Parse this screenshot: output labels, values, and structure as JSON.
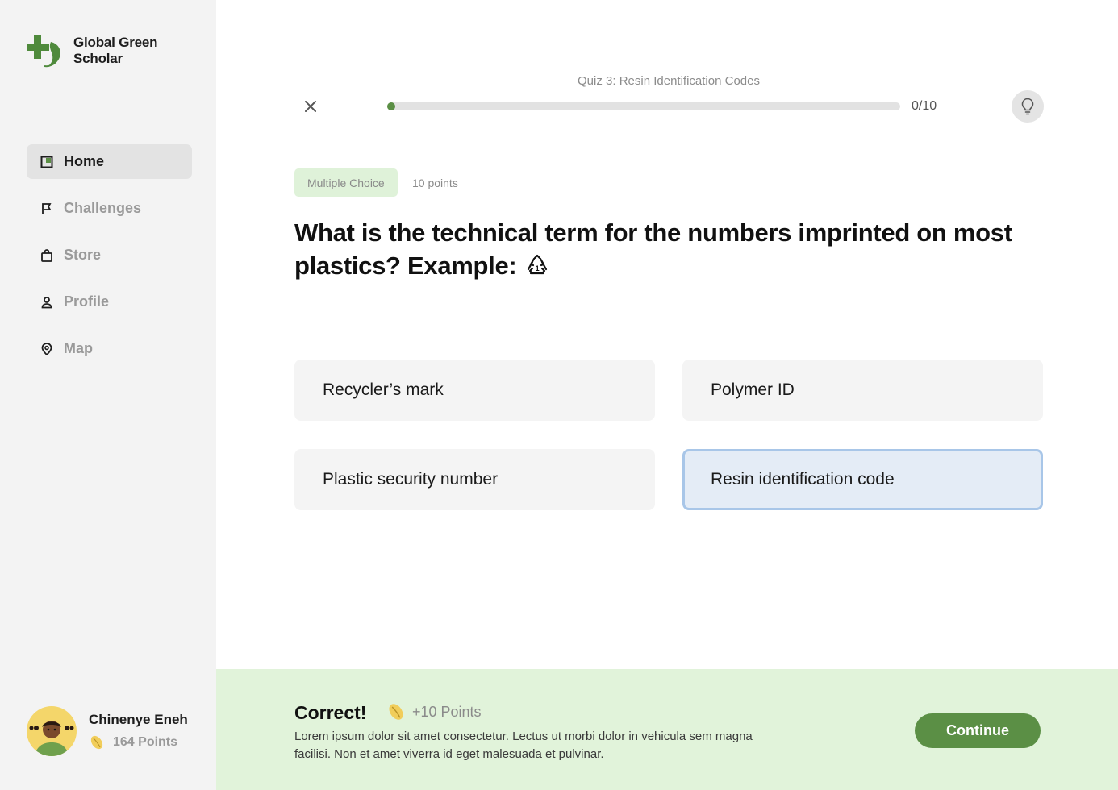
{
  "brand": {
    "name_line1": "Global Green",
    "name_line2": "Scholar"
  },
  "sidebar": {
    "items": [
      {
        "label": "Home",
        "icon": "home-icon",
        "active": true
      },
      {
        "label": "Challenges",
        "icon": "flag-icon",
        "active": false
      },
      {
        "label": "Store",
        "icon": "bag-icon",
        "active": false
      },
      {
        "label": "Profile",
        "icon": "person-icon",
        "active": false
      },
      {
        "label": "Map",
        "icon": "pin-icon",
        "active": false
      }
    ]
  },
  "user": {
    "name": "Chinenye Eneh",
    "points": "164 Points"
  },
  "quiz": {
    "title": "Quiz 3: Resin Identification Codes",
    "progress": {
      "current": 0,
      "total": 10,
      "label": "0/10"
    },
    "type_badge": "Multiple Choice",
    "points": "10 points",
    "question": "What is the technical term for the numbers imprinted on most plastics? Example:",
    "options": [
      {
        "label": "Recycler’s mark",
        "selected": false
      },
      {
        "label": "Polymer ID",
        "selected": false
      },
      {
        "label": "Plastic security number",
        "selected": false
      },
      {
        "label": "Resin identification code",
        "selected": true
      }
    ]
  },
  "feedback": {
    "title": "Correct!",
    "points": "+10 Points",
    "text": "Lorem ipsum dolor sit amet consectetur. Lectus ut morbi dolor in vehicula sem magna facilisi. Non et amet viverra id eget malesuada et pulvinar.",
    "continue_label": "Continue"
  },
  "colors": {
    "accent_green": "#5b8f45",
    "feedback_bg": "#e1f3da",
    "selected_bg": "#e4ecf6",
    "selected_border": "#a8c6e8",
    "sidebar_bg": "#f3f3f3"
  }
}
